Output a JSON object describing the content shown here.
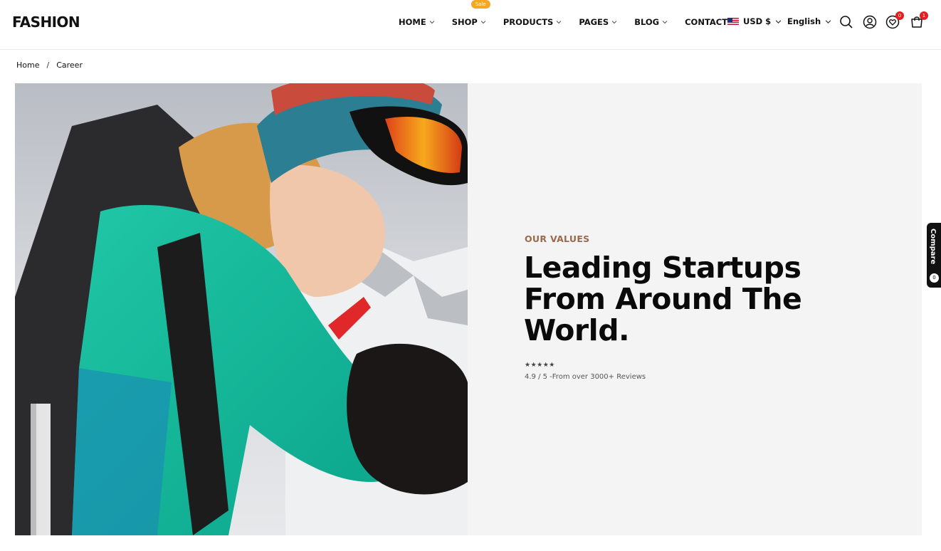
{
  "brand": {
    "logo": "FASHION"
  },
  "nav": {
    "items": [
      {
        "label": "HOME",
        "has_dropdown": true
      },
      {
        "label": "SHOP",
        "has_dropdown": true,
        "badge": "Sale"
      },
      {
        "label": "PRODUCTS",
        "has_dropdown": true
      },
      {
        "label": "PAGES",
        "has_dropdown": true
      },
      {
        "label": "BLOG",
        "has_dropdown": true
      },
      {
        "label": "CONTACT",
        "has_dropdown": false
      }
    ]
  },
  "header_tools": {
    "currency": "USD $",
    "language": "English",
    "wishlist_count": "0",
    "cart_count": "1"
  },
  "breadcrumb": {
    "home": "Home",
    "separator": "/",
    "current": "Career"
  },
  "hero": {
    "eyebrow": "OUR VALUES",
    "heading": "Leading Startups From Around The World.",
    "stars": "★★★★★",
    "rating_text": "4.9 / 5 -From over 3000+ Reviews"
  },
  "compare": {
    "label": "Compare",
    "count": "0"
  },
  "colors": {
    "accent_eyebrow": "#9a6a4a",
    "sale_badge": "#f5a623",
    "count_badge": "#e02020",
    "hero_panel_bg": "#f4f4f4"
  },
  "icons": [
    "search-icon",
    "user-icon",
    "heart-icon",
    "cart-icon",
    "chevron-down-icon",
    "us-flag-icon"
  ]
}
